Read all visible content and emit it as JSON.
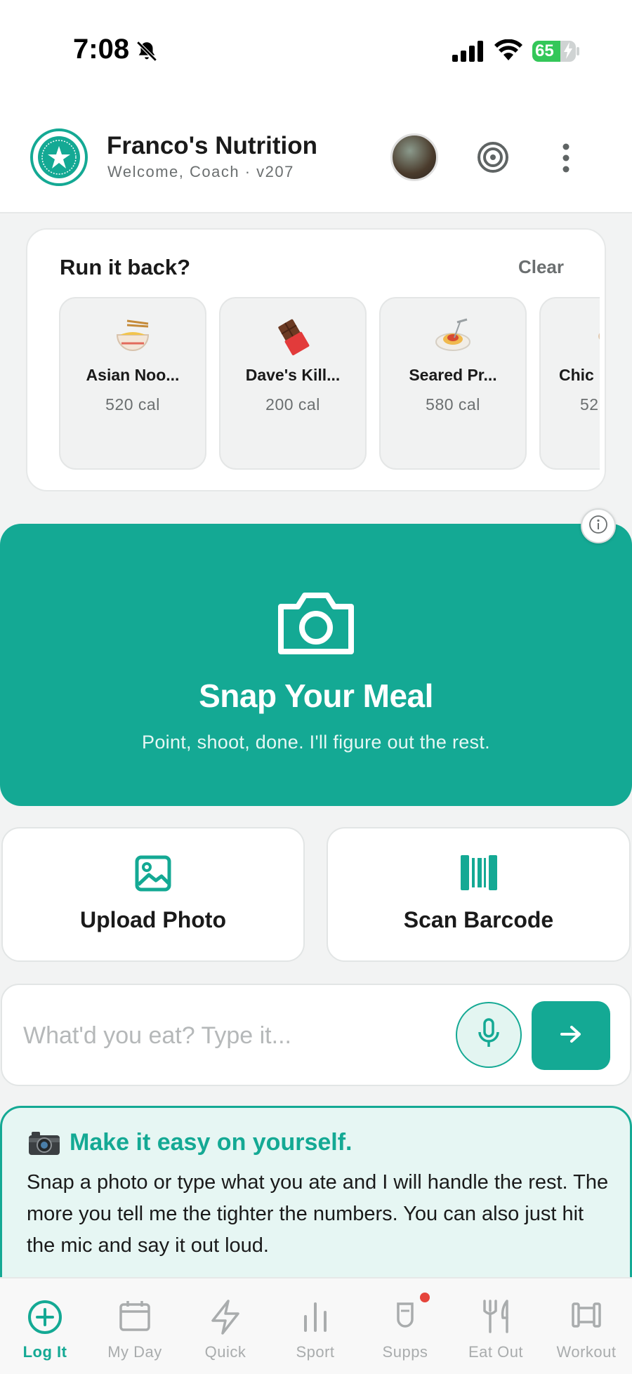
{
  "status_bar": {
    "time": "7:08",
    "battery": "65",
    "battery_level": 0.65
  },
  "header": {
    "title": "Franco's Nutrition",
    "subtitle": "Welcome, Coach · v207"
  },
  "run_it_back": {
    "title": "Run it back?",
    "clear_label": "Clear",
    "items": [
      {
        "name": "Asian Noo...",
        "calories": "520 cal",
        "icon": "noodle-bowl-icon"
      },
      {
        "name": "Dave's Kill...",
        "calories": "200 cal",
        "icon": "chocolate-bar-icon"
      },
      {
        "name": "Seared Pr...",
        "calories": "580 cal",
        "icon": "spaghetti-icon"
      },
      {
        "name": "Chic",
        "calories": "52",
        "icon": "food-icon"
      }
    ]
  },
  "snap": {
    "title": "Snap Your Meal",
    "subtitle": "Point, shoot, done. I'll figure out the rest."
  },
  "actions": {
    "upload_label": "Upload Photo",
    "scan_label": "Scan Barcode"
  },
  "input": {
    "placeholder": "What'd you eat? Type it..."
  },
  "tip": {
    "title": "Make it easy on yourself.",
    "body": "Snap a photo or type what you ate and I will handle the rest. The more you tell me the tighter the numbers. You can also just hit the mic and say it out loud."
  },
  "tabs": [
    {
      "label": "Log It",
      "icon": "plus-circle-icon",
      "active": true
    },
    {
      "label": "My Day",
      "icon": "calendar-icon",
      "active": false
    },
    {
      "label": "Quick",
      "icon": "lightning-icon",
      "active": false
    },
    {
      "label": "Sport",
      "icon": "bar-chart-icon",
      "active": false
    },
    {
      "label": "Supps",
      "icon": "supplement-icon",
      "active": false
    },
    {
      "label": "Eat Out",
      "icon": "fork-knife-icon",
      "active": false
    },
    {
      "label": "Workout",
      "icon": "dumbbell-icon",
      "active": false
    }
  ],
  "colors": {
    "accent": "#14a994",
    "accent_light": "#e6f6f3",
    "notification": "#e5443b",
    "inactive": "#a9acad"
  }
}
